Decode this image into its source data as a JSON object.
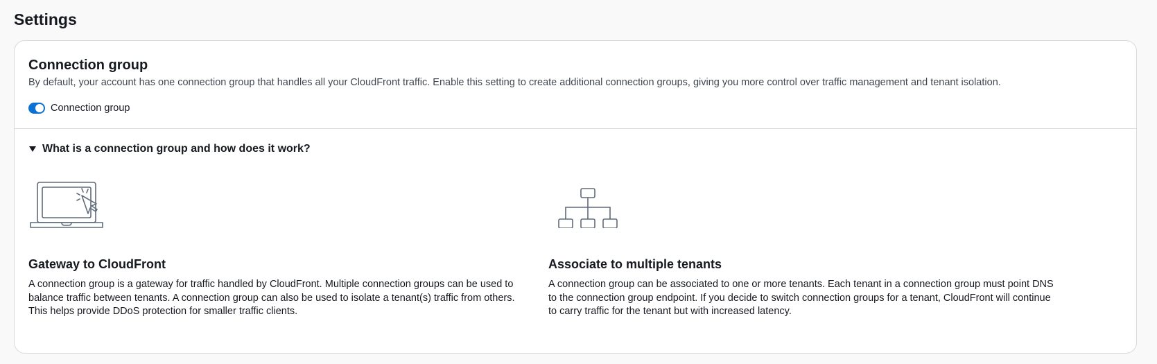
{
  "page": {
    "title": "Settings"
  },
  "connection_group": {
    "title": "Connection group",
    "description": "By default, your account has one connection group that handles all your CloudFront traffic. Enable this setting to create additional connection groups, giving you more control over traffic management and tenant isolation.",
    "toggle": {
      "label": "Connection group",
      "checked": true
    }
  },
  "expander": {
    "label": "What is a connection group and how does it work?",
    "expanded": true
  },
  "features": [
    {
      "icon": "laptop-cursor-icon",
      "title": "Gateway to CloudFront",
      "description": "A connection group is a gateway for traffic handled by CloudFront. Multiple connection groups can be used to balance traffic between tenants. A connection group can also be used to isolate a tenant(s) traffic from others. This helps provide DDoS protection for smaller traffic clients."
    },
    {
      "icon": "hierarchy-icon",
      "title": "Associate to multiple tenants",
      "description": "A connection group can be associated to one or more tenants. Each tenant in a connection group must point DNS to the connection group endpoint. If you decide to switch connection groups for a tenant, CloudFront will continue to carry traffic for the tenant but with increased latency."
    }
  ],
  "colors": {
    "accent": "#0972d3",
    "border": "#d5dbdb",
    "text": "#16191f",
    "icon_stroke": "#5f6b7a"
  }
}
